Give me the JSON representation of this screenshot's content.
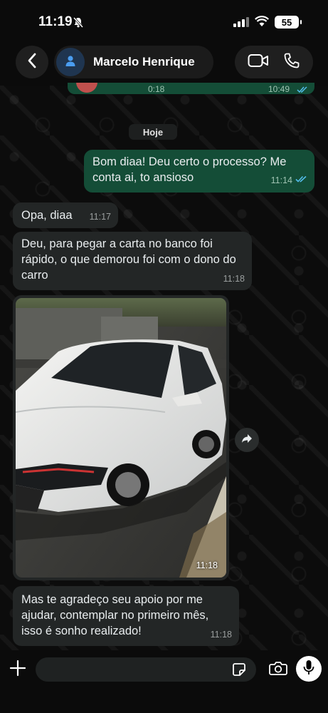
{
  "status_bar": {
    "time": "11:19",
    "battery": "55",
    "icons": [
      "bell-slash-icon",
      "signal-icon",
      "wifi-icon",
      "battery-icon"
    ]
  },
  "header": {
    "contact_name": "Marcelo Henrique",
    "icons": [
      "chevron-left-icon",
      "avatar-person-icon",
      "video-call-icon",
      "phone-icon"
    ]
  },
  "chat": {
    "previous_message": {
      "duration": "0:18",
      "time": "10:49"
    },
    "date_separator": "Hoje",
    "messages": [
      {
        "direction": "out",
        "text": "Bom diaa! Deu certo o processo? Me conta ai, to ansioso",
        "time": "11:14",
        "status": "read"
      },
      {
        "direction": "in",
        "text": "Opa, diaa",
        "time": "11:17"
      },
      {
        "direction": "in",
        "text": "Deu, para pegar a carta no banco foi rápido, o que demorou foi com o dono do carro",
        "time": "11:18"
      },
      {
        "direction": "in",
        "type": "image",
        "image_description": "white hatchback car parked on street",
        "time": "11:18"
      },
      {
        "direction": "in",
        "text": "Mas te agradeço seu apoio por me ajudar, contemplar no primeiro mês, isso é sonho realizado!",
        "time": "11:18"
      }
    ]
  },
  "input_bar": {
    "placeholder": "",
    "icons": [
      "plus-icon",
      "sticker-icon",
      "camera-icon",
      "mic-icon"
    ]
  },
  "colors": {
    "outgoing_bubble": "#144d37",
    "incoming_bubble": "#232626",
    "read_ticks": "#53bdeb",
    "background": "#0b0b0b"
  }
}
